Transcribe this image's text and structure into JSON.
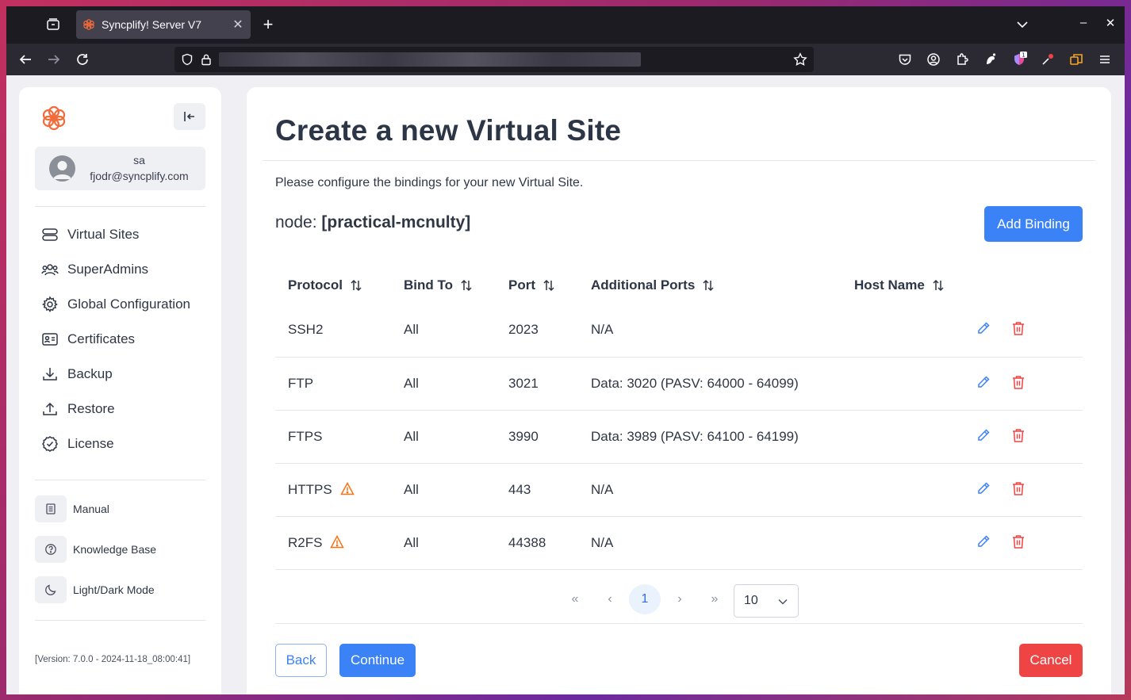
{
  "browser": {
    "tab_title": "Syncplify! Server V7",
    "new_tab": "+",
    "close_tab": "✕",
    "minimize": "–",
    "close_window": "✕",
    "extension_badge": "1"
  },
  "sidebar": {
    "user": {
      "name": "sa",
      "email": "fjodr@syncplify.com"
    },
    "items": [
      {
        "label": "Virtual Sites",
        "icon": "server-icon"
      },
      {
        "label": "SuperAdmins",
        "icon": "users-icon"
      },
      {
        "label": "Global Configuration",
        "icon": "gear-icon"
      },
      {
        "label": "Certificates",
        "icon": "id-card-icon"
      },
      {
        "label": "Backup",
        "icon": "download-icon"
      },
      {
        "label": "Restore",
        "icon": "upload-icon"
      },
      {
        "label": "License",
        "icon": "check-circle-icon"
      }
    ],
    "secondary": [
      {
        "label": "Manual",
        "icon": "document-icon"
      },
      {
        "label": "Knowledge Base",
        "icon": "help-circle-icon"
      },
      {
        "label": "Light/Dark Mode",
        "icon": "moon-icon"
      }
    ],
    "version": "[Version: 7.0.0 - 2024-11-18_08:00:41]"
  },
  "main": {
    "title": "Create a new Virtual Site",
    "instructions": "Please configure the bindings for your new Virtual Site.",
    "node_label": "node:",
    "node_value": "[practical-mcnulty]",
    "add_binding": "Add Binding",
    "columns": [
      "Protocol",
      "Bind To",
      "Port",
      "Additional Ports",
      "Host Name"
    ],
    "rows": [
      {
        "protocol": "SSH2",
        "bind_to": "All",
        "port": "2023",
        "additional": "N/A",
        "host": "",
        "warning": false
      },
      {
        "protocol": "FTP",
        "bind_to": "All",
        "port": "3021",
        "additional": "Data: 3020 (PASV: 64000 - 64099)",
        "host": "",
        "warning": false
      },
      {
        "protocol": "FTPS",
        "bind_to": "All",
        "port": "3990",
        "additional": "Data: 3989 (PASV: 64100 - 64199)",
        "host": "",
        "warning": false
      },
      {
        "protocol": "HTTPS",
        "bind_to": "All",
        "port": "443",
        "additional": "N/A",
        "host": "",
        "warning": true
      },
      {
        "protocol": "R2FS",
        "bind_to": "All",
        "port": "44388",
        "additional": "N/A",
        "host": "",
        "warning": true
      }
    ],
    "pagination": {
      "first": "«",
      "prev": "‹",
      "current": "1",
      "next": "›",
      "last": "»",
      "page_size": "10"
    },
    "back": "Back",
    "continue": "Continue",
    "cancel": "Cancel"
  },
  "colors": {
    "primary": "#3b82f6",
    "danger": "#ef4444",
    "warning": "#f97316",
    "logo": "#f26b3a"
  }
}
